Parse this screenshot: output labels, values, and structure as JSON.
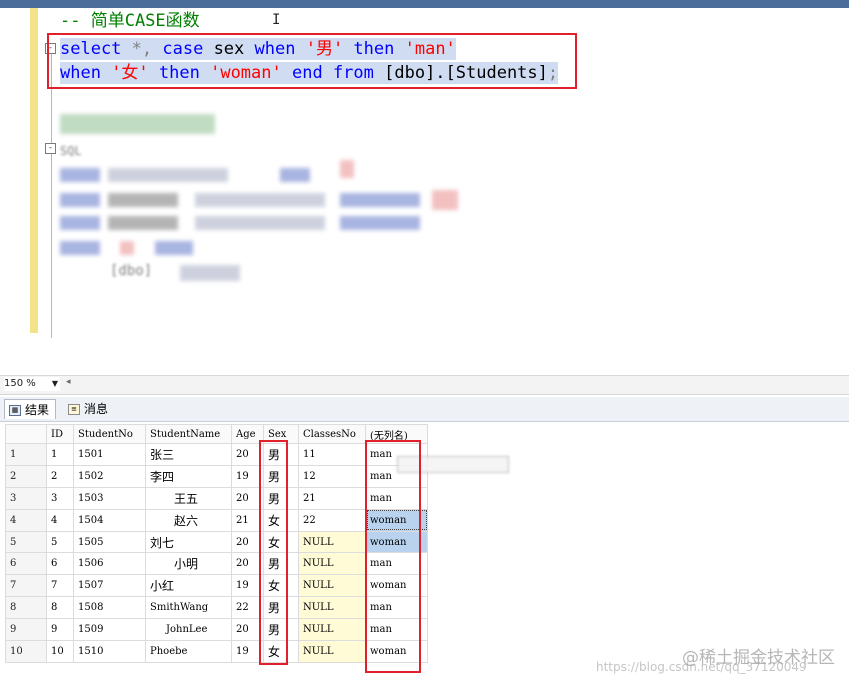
{
  "editor": {
    "comment": "-- 简单CASE函数",
    "line1": {
      "kw_select": "select",
      "star": " *, ",
      "kw_case": "case",
      "col_sex": " sex ",
      "kw_when": "when",
      "str_male": " '男' ",
      "kw_then": "then",
      "str_man": " 'man'"
    },
    "line2": {
      "kw_when": "when",
      "str_female": " '女' ",
      "kw_then": "then",
      "str_woman": " 'woman' ",
      "kw_end": "end",
      "kw_from": " from ",
      "table": "[dbo].[Students]",
      "semicolon": ";"
    },
    "blurred_line_prefix": "SQL",
    "blurred_fragment": "[dbo]"
  },
  "zoom": {
    "value": "150 %"
  },
  "tabs": [
    {
      "label": "结果",
      "active": true
    },
    {
      "label": "消息",
      "active": false
    }
  ],
  "grid": {
    "columns": [
      "",
      "ID",
      "StudentNo",
      "StudentName",
      "Age",
      "Sex",
      "ClassesNo",
      "(无列名)"
    ],
    "rows": [
      [
        "1",
        "1",
        "1501",
        "张三",
        "20",
        "男",
        "11",
        "man"
      ],
      [
        "2",
        "2",
        "1502",
        "李四",
        "19",
        "男",
        "12",
        "man"
      ],
      [
        "3",
        "3",
        "1503",
        "王五",
        "20",
        "男",
        "21",
        "man"
      ],
      [
        "4",
        "4",
        "1504",
        "赵六",
        "21",
        "女",
        "22",
        "woman"
      ],
      [
        "5",
        "5",
        "1505",
        "刘七",
        "20",
        "女",
        "NULL",
        "woman"
      ],
      [
        "6",
        "6",
        "1506",
        "小明",
        "20",
        "男",
        "NULL",
        "man"
      ],
      [
        "7",
        "7",
        "1507",
        "小红",
        "19",
        "女",
        "NULL",
        "woman"
      ],
      [
        "8",
        "8",
        "1508",
        "SmithWang",
        "22",
        "男",
        "NULL",
        "man"
      ],
      [
        "9",
        "9",
        "1509",
        "JohnLee",
        "20",
        "男",
        "NULL",
        "man"
      ],
      [
        "10",
        "10",
        "1510",
        "Phoebe",
        "19",
        "女",
        "NULL",
        "woman"
      ]
    ]
  },
  "watermark": {
    "main": "@稀土掘金技术社区",
    "url": "https://blog.csdn.net/qq_37120049"
  },
  "colors": {
    "keyword": "#0000ff",
    "string": "#ff0000",
    "comment": "#008000",
    "highlight_box": "#e0202a",
    "null_cell": "#fffbd6",
    "selected_cell": "#b9d3ee"
  }
}
